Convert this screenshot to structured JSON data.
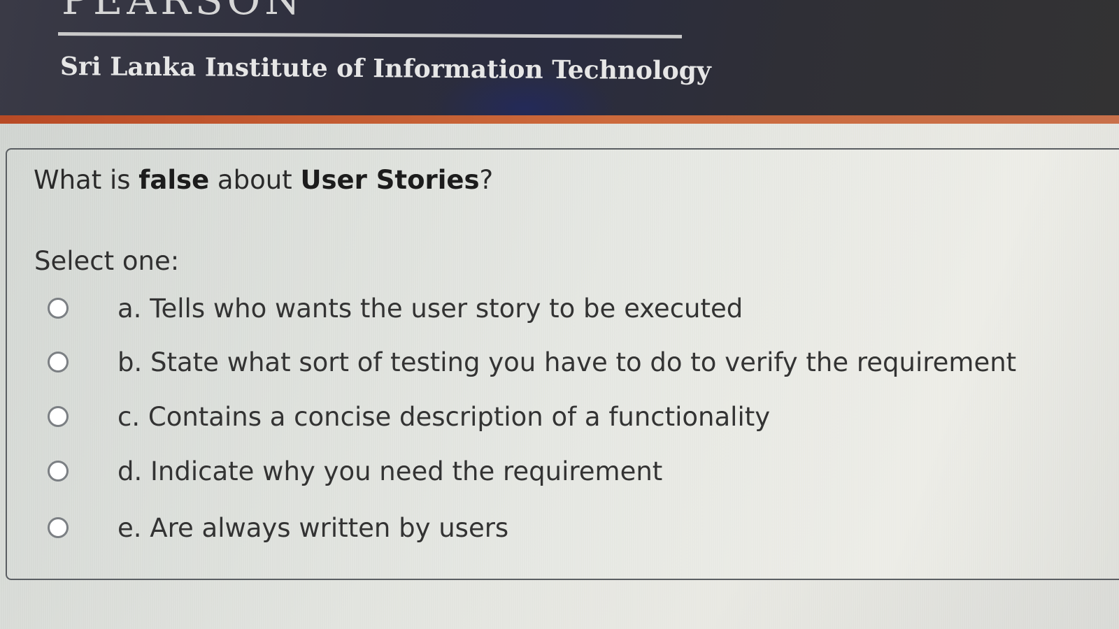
{
  "header": {
    "logo_text": "PEARSON",
    "institute_name": "Sri Lanka Institute of Information Technology"
  },
  "question": {
    "parts": [
      {
        "text": "What is ",
        "bold": false
      },
      {
        "text": "false",
        "bold": true
      },
      {
        "text": " about ",
        "bold": false
      },
      {
        "text": "User Stories",
        "bold": true
      },
      {
        "text": "?",
        "bold": false
      }
    ],
    "prompt": "Select one:",
    "options": [
      {
        "label": "a. Tells who wants the user story to be executed",
        "selected": false
      },
      {
        "label": "b. State what sort of testing you have to do to verify the requirement",
        "selected": false
      },
      {
        "label": "c. Contains a concise description of a functionality",
        "selected": false
      },
      {
        "label": "d. Indicate why you need the requirement",
        "selected": false
      },
      {
        "label": "e. Are always written by users",
        "selected": false
      }
    ]
  },
  "colors": {
    "header_bg": "#2c2d3c",
    "accent_bar": "#c45a30",
    "content_bg": "#e1e3de",
    "box_border": "#5a5e62",
    "radio_border": "#7b7f83"
  }
}
